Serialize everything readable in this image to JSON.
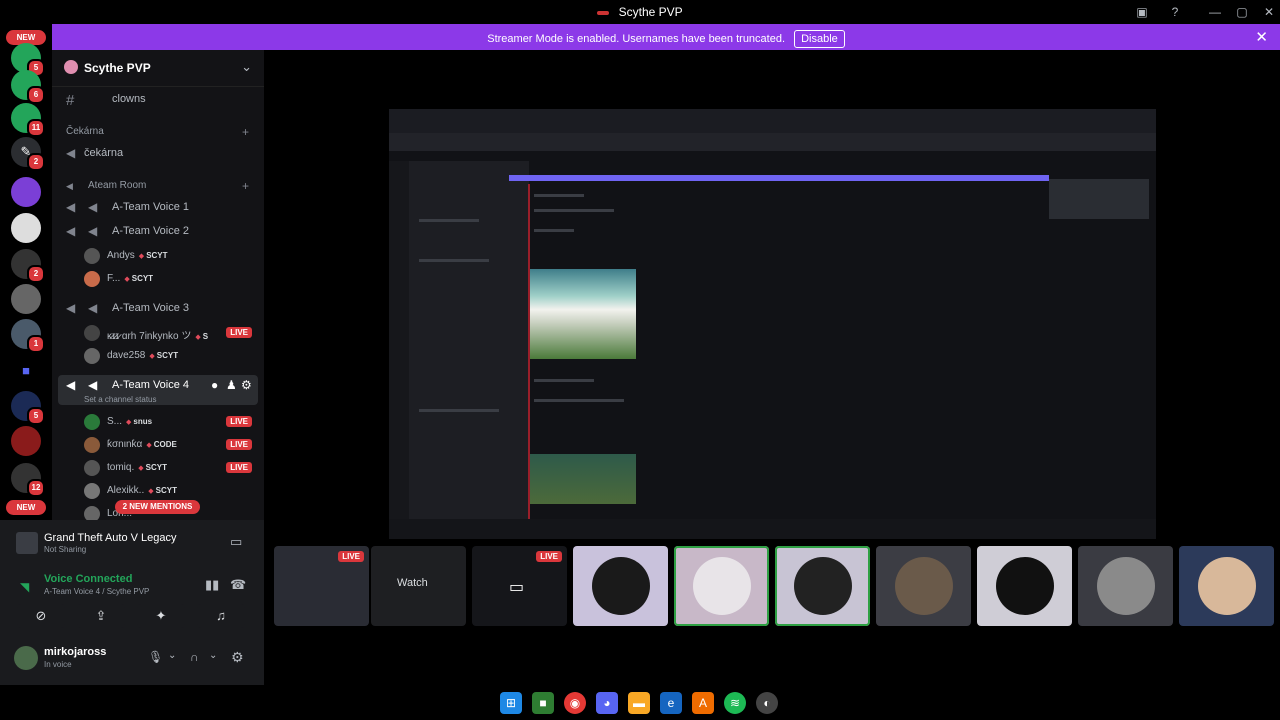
{
  "window": {
    "title": "Scythe PVP",
    "controls": [
      "—",
      "▢",
      "✕"
    ]
  },
  "banner": {
    "message": "Streamer Mode is enabled. Usernames have been truncated.",
    "disable_label": "Disable",
    "close_icon": "✕"
  },
  "rail": {
    "new_top": "NEW",
    "new_bottom": "NEW",
    "badges": [
      "5",
      "6",
      "11",
      "2",
      "2",
      "1",
      "5",
      "12"
    ]
  },
  "sidebar": {
    "server_name": "Scythe PVP",
    "channels": {
      "clowns": "clowns",
      "waiting_category": "Čekárna",
      "waiting_voice": "čekárna",
      "ateam_category": "Ateam Room",
      "voice1": "A-Team Voice 1",
      "voice2": "A-Team Voice 2",
      "voice3": "A-Team Voice 3",
      "voice4": "A-Team Voice 4",
      "voice4_status": "Set a channel status"
    },
    "voice2_users": [
      {
        "name": "Andys",
        "tag": "SCYT"
      },
      {
        "name": "F...",
        "tag": "SCYT"
      }
    ],
    "voice3_users": [
      {
        "name": "ᴋ̷ɪ̷ɪ̷ ɑrh 7inkynko ツ",
        "tag": "S",
        "live": "LIVE"
      },
      {
        "name": "dave258",
        "tag": "SCYT"
      }
    ],
    "voice4_users": [
      {
        "name": "S...",
        "tag": "snus",
        "live": "LIVE"
      },
      {
        "name": "ƙσnιnƙα",
        "tag": "CODE",
        "live": "LIVE"
      },
      {
        "name": "tomiq.",
        "tag": "SCYT",
        "live": "LIVE"
      },
      {
        "name": "Alexikk..",
        "tag": "SCYT"
      },
      {
        "name": "Lon...",
        "tag": ""
      }
    ],
    "mentions_pill": "2 NEW MENTIONS"
  },
  "panel": {
    "game_title": "Grand Theft Auto V Legacy",
    "game_sub": "Not Sharing",
    "voice_status": "Voice Connected",
    "voice_location": "A-Team Voice 4 / Scythe PVP",
    "username": "mirkojaross",
    "user_status": "In voice"
  },
  "tiles": {
    "live_label": "LIVE",
    "watch_label": "Watch"
  },
  "colors": {
    "banner": "#8c39e8",
    "live": "#da373c",
    "voice_green": "#23a55a",
    "speaking": "#2ea043"
  },
  "icons": {
    "hash": "#",
    "speaker": "🔊",
    "plus": "+",
    "gear": "⚙",
    "mic": "🎤",
    "headphones": "🎧",
    "chevron": "⌄"
  }
}
